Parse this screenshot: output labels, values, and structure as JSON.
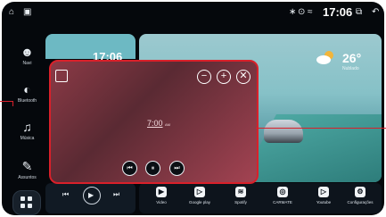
{
  "status": {
    "time": "17:06",
    "home_glyph": "⌂",
    "shot_glyph": "▣",
    "bt_glyph": "∗",
    "loc_glyph": "⊙",
    "wifi_glyph": "≈",
    "split_glyph": "⧉",
    "back_glyph": "↶"
  },
  "sidebar": {
    "items": [
      {
        "label": "Navi",
        "icon": "user-pin-icon",
        "glyph": "☻"
      },
      {
        "label": "Bluetooth",
        "icon": "bluetooth-icon",
        "glyph": "◐"
      },
      {
        "label": "Música",
        "icon": "music-icon",
        "glyph": "♫"
      },
      {
        "label": "Assuntos",
        "icon": "brush-icon",
        "glyph": "✎"
      }
    ]
  },
  "clock_widget": {
    "time": "17:06"
  },
  "weather": {
    "temp": "26°",
    "label": "Nublado"
  },
  "overlay": {
    "time": "7:00",
    "time_suffix": "AM",
    "minus": "−",
    "plus": "+",
    "close": "✕",
    "prev": "⏮",
    "pause": "⏸",
    "next": "⏭"
  },
  "media": {
    "prev": "⏮",
    "play": "▶",
    "next": "⏭"
  },
  "dock": {
    "apps": [
      {
        "label": "Video",
        "glyph": "▶"
      },
      {
        "label": "Google play",
        "glyph": "▷"
      },
      {
        "label": "Spotify",
        "glyph": "≋"
      },
      {
        "label": "CARMATE",
        "glyph": "◎"
      },
      {
        "label": "Youtube",
        "glyph": "▷"
      },
      {
        "label": "Configurações",
        "glyph": "⚙"
      }
    ]
  },
  "colors": {
    "highlight": "#d9202a",
    "accent": "#6db9c3"
  }
}
